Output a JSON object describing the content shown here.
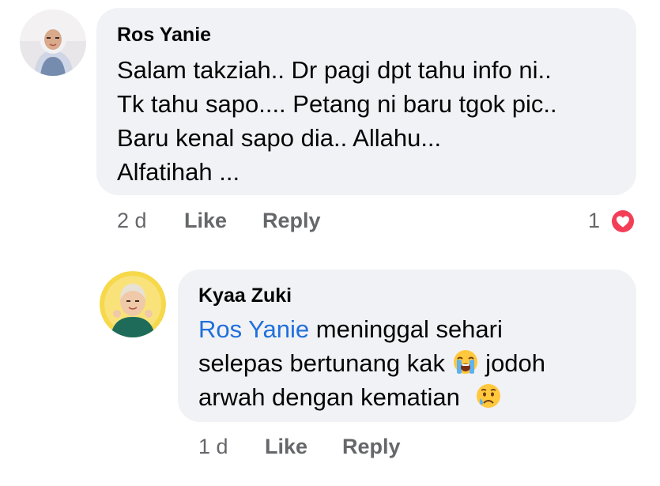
{
  "comment1": {
    "author": "Ros Yanie",
    "lines": [
      "Salam takziah.. Dr pagi dpt tahu info ni..",
      "Tk tahu sapo.... Petang ni baru tgok pic..",
      "Baru kenal sapo dia.. Allahu...",
      "Alfatihah ..."
    ],
    "time": "2 d",
    "like_label": "Like",
    "reply_label": "Reply",
    "reaction_count": "1",
    "reaction_icon": "love-reaction-icon"
  },
  "comment2": {
    "author": "Kyaa Zuki",
    "mention": "Ros Yanie",
    "line1_rest": " meninggal sehari",
    "line2_text": "selepas bertunang kak ",
    "line2_emoji": "loudly-crying-face-icon",
    "line2_after": " jodoh",
    "line3_text": "arwah dengan kematian ",
    "line3_emoji": "crying-face-icon",
    "time": "1 d",
    "like_label": "Like",
    "reply_label": "Reply"
  },
  "colors": {
    "bubble": "#f0f2f5",
    "mention": "#216fdb",
    "meta": "#65676b",
    "love_reaction": "#f33e58"
  }
}
